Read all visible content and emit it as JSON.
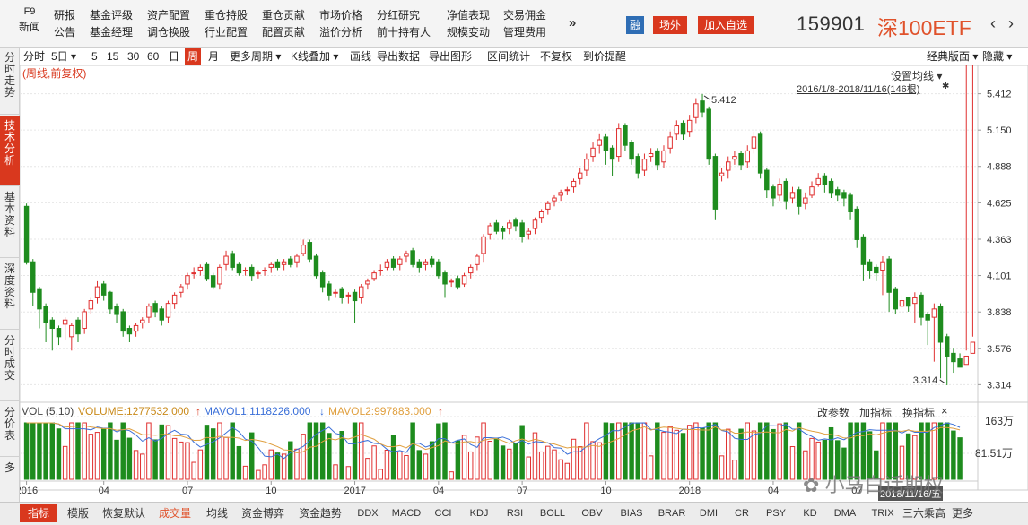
{
  "header": {
    "f9": "F9",
    "f9_sub": "新闻",
    "menu_cols": [
      [
        "研报",
        "公告"
      ],
      [
        "基金评级",
        "基金经理"
      ],
      [
        "资产配置",
        "调仓换股"
      ],
      [
        "重仓持股",
        "行业配置"
      ],
      [
        "重仓贡献",
        "配置贡献"
      ],
      [
        "市场价格",
        "溢价分析"
      ],
      [
        "分红研究",
        "前十持有人"
      ],
      [
        "净值表现",
        "规模变动"
      ],
      [
        "交易佣金",
        "管理费用"
      ]
    ],
    "more": "»",
    "rong": "融",
    "btn_outside": "场外",
    "btn_watch": "加入自选",
    "code": "159901",
    "name": "深100ETF",
    "prev": "‹",
    "next": "›"
  },
  "toolbar": {
    "items": [
      "分时",
      "5日 ▾",
      "5",
      "15",
      "30",
      "60",
      "日",
      "周",
      "月",
      "更多周期 ▾",
      "K线叠加 ▾",
      "画线",
      "导出数据",
      "导出图形",
      "区间统计",
      "不复权",
      "到价提醒"
    ],
    "active": "周",
    "right": [
      "经典版面 ▾",
      "隐藏 ▾"
    ]
  },
  "left_tabs": [
    "分时走势",
    "技术分析",
    "基本资料",
    "深度资料",
    "分时成交",
    "分价表",
    "多"
  ],
  "chart": {
    "period_label": "(周线,前复权)",
    "ma_setting": "设置均线 ▾",
    "range": "2016/1/8-2018/11/16(146根)",
    "pin": "✱",
    "high_label": "5.412",
    "low_label": "3.314",
    "up_color": "#e03030",
    "down_color": "#1e8c1e",
    "volume": {
      "title": "VOL (5,10)",
      "volume": "VOLUME:1277532.000",
      "mavol1": "MAVOL1:1118226.000",
      "mavol2": "MAVOL2:997883.000",
      "actions": [
        "改参数",
        "加指标",
        "换指标"
      ],
      "close": "×",
      "yticks": [
        "163万",
        "81.51万"
      ]
    },
    "date_label": "2018/11/16/五"
  },
  "bottom_tabs": [
    "指标",
    "模版",
    "恢复默认",
    "成交量",
    "均线",
    "资金博弈",
    "资金趋势",
    "DDX",
    "MACD",
    "CCI",
    "KDJ",
    "RSI",
    "BOLL",
    "OBV",
    "BIAS",
    "BRAR",
    "DMI",
    "CR",
    "PSY",
    "KD",
    "DMA",
    "TRIX",
    "三六乘高",
    "更多"
  ],
  "watermark": "小马白话期权",
  "chart_data": {
    "type": "candlestick",
    "title": "(周线,前复权)",
    "ylim": [
      3.2,
      5.5
    ],
    "yticks": [
      "5.412",
      "5.150",
      "4.888",
      "4.625",
      "4.363",
      "4.101",
      "3.838",
      "3.576",
      "3.314"
    ],
    "xticks": [
      "2016",
      "04",
      "07",
      "10",
      "2017",
      "04",
      "07",
      "10",
      "2018",
      "04",
      "07"
    ],
    "xtick_index": [
      0,
      12,
      25,
      38,
      51,
      64,
      77,
      90,
      103,
      116,
      129
    ],
    "open": [
      4.6,
      4.2,
      4.0,
      3.88,
      3.78,
      3.72,
      3.75,
      3.66,
      3.78,
      3.72,
      3.86,
      3.94,
      4.04,
      3.98,
      3.88,
      3.84,
      3.72,
      3.7,
      3.76,
      3.8,
      3.9,
      3.86,
      3.8,
      3.9,
      3.98,
      4.04,
      4.12,
      4.14,
      4.18,
      4.1,
      4.04,
      4.18,
      4.26,
      4.18,
      4.14,
      4.16,
      4.12,
      4.14,
      4.16,
      4.2,
      4.18,
      4.22,
      4.2,
      4.26,
      4.34,
      4.24,
      4.12,
      4.04,
      3.98,
      4.0,
      3.96,
      3.98,
      3.94,
      4.04,
      4.08,
      4.14,
      4.16,
      4.22,
      4.18,
      4.24,
      4.28,
      4.2,
      4.18,
      4.22,
      4.2,
      4.12,
      4.06,
      4.08,
      4.04,
      4.12,
      4.18,
      4.26,
      4.4,
      4.48,
      4.44,
      4.44,
      4.5,
      4.48,
      4.4,
      4.44,
      4.52,
      4.58,
      4.64,
      4.68,
      4.72,
      4.74,
      4.8,
      4.86,
      4.96,
      5.04,
      5.1,
      5.02,
      4.96,
      5.18,
      5.06,
      4.96,
      4.86,
      4.96,
      5.0,
      4.92,
      5.02,
      5.12,
      5.2,
      5.14,
      5.24,
      5.36,
      5.3,
      4.96,
      4.82,
      4.86,
      4.94,
      4.98,
      4.92,
      5.02,
      5.12,
      4.86,
      4.74,
      4.68,
      4.78,
      4.66,
      4.72,
      4.62,
      4.68,
      4.76,
      4.82,
      4.78,
      4.72,
      4.7,
      4.68,
      4.58,
      4.38,
      4.2,
      4.16,
      4.14,
      4.22,
      4.0,
      3.88,
      3.94,
      3.9,
      3.96,
      3.82,
      3.8,
      3.88,
      3.66,
      3.54,
      3.5,
      3.46,
      3.54
    ],
    "close": [
      4.2,
      3.98,
      3.86,
      3.76,
      3.72,
      3.66,
      3.78,
      3.74,
      3.68,
      3.84,
      3.92,
      4.02,
      3.96,
      3.86,
      3.82,
      3.7,
      3.68,
      3.74,
      3.78,
      3.88,
      3.84,
      3.78,
      3.9,
      3.96,
      4.02,
      4.1,
      4.12,
      4.16,
      4.08,
      4.02,
      4.16,
      4.24,
      4.16,
      4.12,
      4.14,
      4.1,
      4.12,
      4.14,
      4.18,
      4.16,
      4.2,
      4.18,
      4.24,
      4.32,
      4.22,
      4.1,
      4.02,
      3.96,
      3.98,
      3.94,
      3.96,
      3.92,
      4.02,
      4.06,
      4.12,
      4.14,
      4.2,
      4.16,
      4.22,
      4.26,
      4.18,
      4.16,
      4.2,
      4.18,
      4.1,
      4.04,
      4.06,
      4.02,
      4.1,
      4.16,
      4.24,
      4.38,
      4.46,
      4.42,
      4.42,
      4.48,
      4.46,
      4.38,
      4.42,
      4.5,
      4.56,
      4.62,
      4.66,
      4.7,
      4.72,
      4.78,
      4.84,
      4.94,
      5.02,
      5.08,
      5.0,
      4.94,
      5.16,
      5.04,
      4.94,
      4.84,
      4.94,
      4.98,
      4.9,
      5.0,
      5.1,
      5.18,
      5.12,
      5.22,
      5.34,
      5.28,
      4.94,
      4.58,
      4.84,
      4.92,
      4.96,
      4.9,
      5.0,
      5.1,
      4.84,
      4.72,
      4.66,
      4.76,
      4.64,
      4.7,
      4.6,
      4.66,
      4.74,
      4.8,
      4.76,
      4.7,
      4.68,
      4.66,
      4.56,
      4.36,
      4.18,
      4.14,
      4.12,
      4.2,
      3.98,
      3.86,
      3.92,
      3.88,
      3.94,
      3.8,
      3.78,
      3.86,
      3.62,
      3.52,
      3.48,
      3.44,
      3.52,
      3.62
    ],
    "high": [
      4.62,
      4.22,
      4.02,
      3.9,
      3.8,
      3.74,
      3.8,
      3.76,
      3.8,
      3.86,
      3.94,
      4.06,
      4.06,
      3.99,
      3.9,
      3.86,
      3.74,
      3.76,
      3.8,
      3.9,
      3.92,
      3.88,
      3.92,
      3.98,
      4.04,
      4.12,
      4.16,
      4.18,
      4.2,
      4.12,
      4.18,
      4.28,
      4.28,
      4.2,
      4.16,
      4.18,
      4.14,
      4.16,
      4.2,
      4.22,
      4.22,
      4.24,
      4.26,
      4.36,
      4.36,
      4.26,
      4.14,
      4.06,
      4.0,
      4.02,
      3.98,
      4.0,
      4.04,
      4.08,
      4.14,
      4.18,
      4.22,
      4.24,
      4.24,
      4.28,
      4.3,
      4.22,
      4.22,
      4.24,
      4.22,
      4.14,
      4.08,
      4.1,
      4.12,
      4.18,
      4.26,
      4.4,
      4.48,
      4.5,
      4.46,
      4.5,
      4.52,
      4.5,
      4.44,
      4.52,
      4.58,
      4.64,
      4.68,
      4.72,
      4.74,
      4.8,
      4.88,
      4.98,
      5.06,
      5.12,
      5.12,
      5.04,
      5.2,
      5.2,
      5.08,
      4.98,
      4.98,
      5.02,
      5.02,
      5.04,
      5.14,
      5.22,
      5.22,
      5.26,
      5.38,
      5.41,
      5.32,
      4.98,
      4.88,
      4.96,
      5.0,
      5.0,
      5.04,
      5.14,
      5.14,
      4.88,
      4.76,
      4.8,
      4.8,
      4.74,
      4.74,
      4.7,
      4.78,
      4.84,
      4.84,
      4.8,
      4.74,
      4.72,
      4.7,
      4.6,
      4.4,
      4.22,
      4.18,
      4.24,
      4.24,
      4.02,
      3.96,
      3.94,
      3.98,
      3.98,
      3.84,
      3.9,
      3.9,
      3.68,
      3.58,
      3.54,
      3.56,
      3.66
    ],
    "low": [
      4.18,
      3.88,
      3.72,
      3.62,
      3.56,
      3.6,
      3.64,
      3.56,
      3.62,
      3.68,
      3.82,
      3.9,
      3.92,
      3.82,
      3.76,
      3.66,
      3.62,
      3.66,
      3.72,
      3.76,
      3.8,
      3.74,
      3.76,
      3.86,
      3.94,
      4.0,
      4.08,
      4.1,
      4.06,
      4.0,
      4.0,
      4.14,
      4.14,
      4.1,
      4.1,
      4.06,
      4.08,
      4.1,
      4.12,
      4.14,
      4.14,
      4.16,
      4.16,
      4.24,
      4.2,
      4.08,
      3.98,
      3.92,
      3.94,
      3.9,
      3.9,
      3.76,
      3.9,
      4.0,
      4.06,
      4.1,
      4.14,
      4.14,
      4.14,
      4.2,
      4.16,
      4.12,
      4.14,
      4.16,
      4.08,
      3.94,
      4.02,
      4.0,
      4.02,
      4.08,
      4.14,
      4.2,
      4.36,
      4.4,
      4.36,
      4.4,
      4.42,
      4.34,
      4.36,
      4.4,
      4.48,
      4.54,
      4.6,
      4.64,
      4.68,
      4.7,
      4.76,
      4.82,
      4.92,
      4.98,
      4.9,
      4.82,
      4.92,
      5.0,
      4.9,
      4.8,
      4.82,
      4.92,
      4.86,
      4.88,
      4.98,
      5.08,
      5.08,
      5.1,
      5.2,
      5.24,
      4.9,
      4.5,
      4.78,
      4.8,
      4.9,
      4.86,
      4.88,
      4.98,
      4.8,
      4.66,
      4.6,
      4.64,
      4.58,
      4.62,
      4.54,
      4.58,
      4.66,
      4.74,
      4.7,
      4.66,
      4.64,
      4.6,
      4.5,
      4.3,
      4.06,
      4.08,
      4.06,
      3.96,
      3.84,
      3.82,
      3.86,
      3.84,
      3.76,
      3.74,
      3.6,
      3.48,
      3.36,
      3.31,
      3.4,
      3.46
    ],
    "volume_max": "163万"
  }
}
